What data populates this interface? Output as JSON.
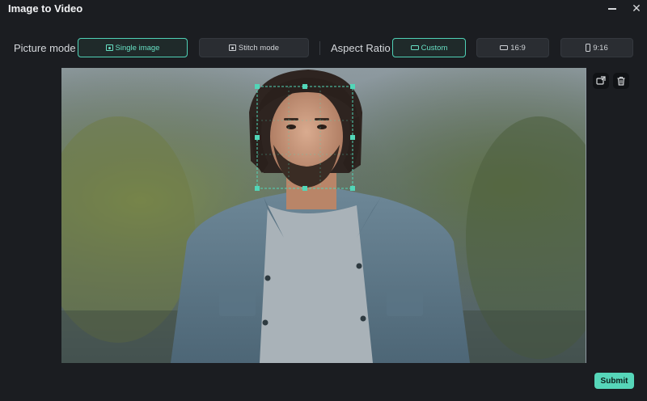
{
  "window": {
    "title": "Image to Video",
    "controls": {
      "minimize": "minimize-icon",
      "close": "close-icon"
    }
  },
  "picture_mode": {
    "label": "Picture mode",
    "options": [
      {
        "label": "Single image",
        "icon": "image-icon",
        "selected": true
      },
      {
        "label": "Stitch mode",
        "icon": "image-icon",
        "selected": false
      }
    ]
  },
  "aspect_ratio": {
    "label": "Aspect Ratio",
    "options": [
      {
        "label": "Custom",
        "icon": "landscape-frame-icon",
        "selected": true
      },
      {
        "label": "16:9",
        "icon": "landscape-frame-icon",
        "selected": false
      },
      {
        "label": "9:16",
        "icon": "portrait-frame-icon",
        "selected": false
      }
    ]
  },
  "canvas": {
    "content": "photo-preview",
    "crop_handles": 8,
    "side_tools": [
      "replace-image-icon",
      "trash-icon"
    ]
  },
  "footer": {
    "submit_label": "Submit"
  },
  "colors": {
    "accent": "#4fd1b6",
    "background": "#1b1d21",
    "button": "#2a2d32"
  }
}
